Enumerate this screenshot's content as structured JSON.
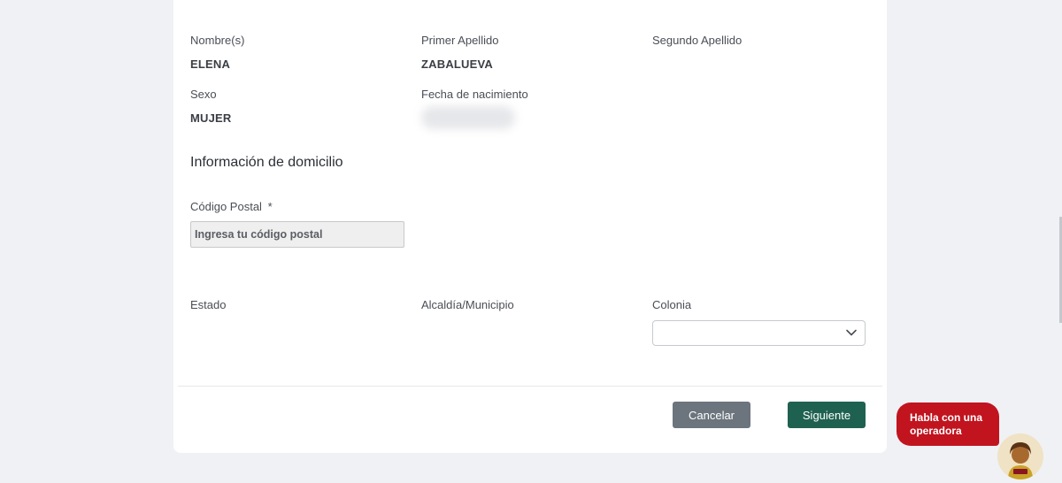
{
  "personal": {
    "first_name_label": "Nombre(s)",
    "first_name_value": "ELENA",
    "last_name1_label": "Primer Apellido",
    "last_name1_value": "ZABALUEVA",
    "last_name2_label": "Segundo Apellido",
    "sex_label": "Sexo",
    "sex_value": "MUJER",
    "birthdate_label": "Fecha de nacimiento"
  },
  "address": {
    "section_title": "Información de domicilio",
    "postal_label": "Código Postal",
    "postal_required": "*",
    "postal_placeholder": "Ingresa tu código postal",
    "postal_value": "",
    "state_label": "Estado",
    "municipality_label": "Alcaldía/Municipio",
    "colonia_label": "Colonia",
    "colonia_value": ""
  },
  "actions": {
    "cancel_label": "Cancelar",
    "next_label": "Siguiente"
  },
  "chat": {
    "line1": "Habla con una",
    "line2": "operadora"
  },
  "colors": {
    "next_button": "#1f6150",
    "cancel_button": "#6c757d",
    "chat_bubble": "#c1141f"
  },
  "icons": {
    "colonia_dropdown": "chevron-down-icon",
    "chat_avatar": "operator-avatar-icon"
  }
}
